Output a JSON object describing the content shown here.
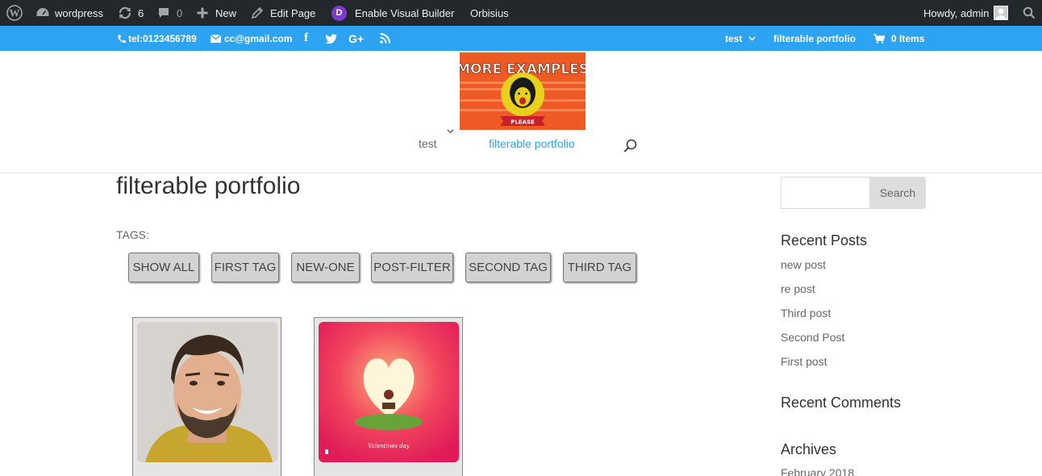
{
  "admin_bar": {
    "site_name": "wordpress",
    "updates_count": "6",
    "comments_count": "0",
    "new_label": "New",
    "edit_page_label": "Edit Page",
    "visual_builder_label": "Enable Visual Builder",
    "theme_label": "Orbisius",
    "howdy_label": "Howdy, admin",
    "divi_letter": "D"
  },
  "top_header": {
    "phone": "tel:0123456789",
    "email": "cc@gmail.com",
    "menu_test": "test",
    "menu_portfolio": "filterable portfolio",
    "cart_label": "0 Items"
  },
  "logo": {
    "line1": "MORE EXAMPLES",
    "banner": "PLEASE"
  },
  "main_nav": {
    "test_label": "test",
    "portfolio_label": "filterable portfolio"
  },
  "page": {
    "title": "filterable portfolio",
    "tags_label": "TAGS:",
    "tags": [
      "SHOW ALL",
      "FIRST TAG",
      "NEW-ONE",
      "POST-FILTER",
      "SECOND TAG",
      "THIRD TAG"
    ],
    "card2_caption": "Valentines day"
  },
  "sidebar": {
    "search_button": "Search",
    "recent_posts_title": "Recent Posts",
    "recent_posts": [
      "new post",
      "re post",
      "Third post",
      "Second Post",
      "First post"
    ],
    "recent_comments_title": "Recent Comments",
    "archives_title": "Archives",
    "archives": [
      "February 2018"
    ]
  },
  "colors": {
    "admin_bar_bg": "#23282d",
    "top_header_bg": "#2ea3f2",
    "accent": "#2ea3f2",
    "logo_bg": "#ef5a24"
  }
}
